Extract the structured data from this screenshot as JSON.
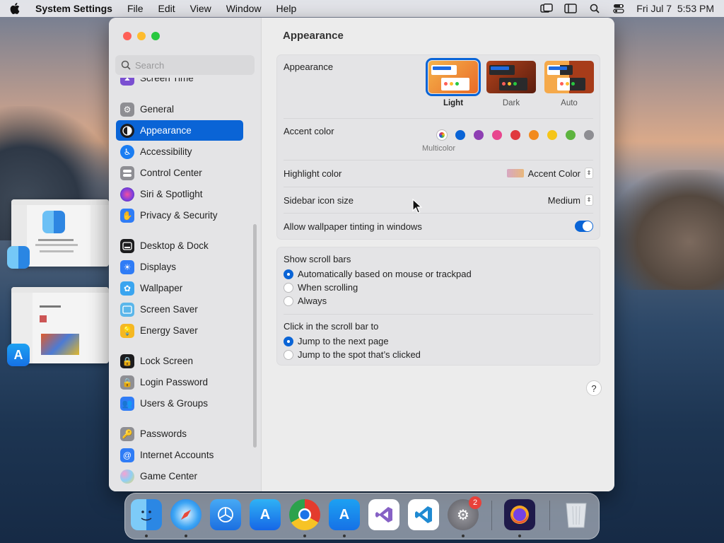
{
  "menubar": {
    "app_name": "System Settings",
    "items": [
      "File",
      "Edit",
      "View",
      "Window",
      "Help"
    ],
    "clock": "Fri Jul 7  5:53 PM"
  },
  "sidebar": {
    "search_placeholder": "Search",
    "partial_item": "Screen Time",
    "items": [
      {
        "label": "General",
        "icon": "gear-icon",
        "color": "#8e8e93"
      },
      {
        "label": "Appearance",
        "icon": "appearance-icon",
        "color": "#1c1c1e",
        "active": true
      },
      {
        "label": "Accessibility",
        "icon": "accessibility-icon",
        "color": "#1a7df2"
      },
      {
        "label": "Control Center",
        "icon": "control-center-icon",
        "color": "#8e8e93"
      },
      {
        "label": "Siri & Spotlight",
        "icon": "siri-icon",
        "color": "#b53cd8"
      },
      {
        "label": "Privacy & Security",
        "icon": "hand-icon",
        "color": "#2f7cf6"
      },
      {
        "label": "Desktop & Dock",
        "icon": "dock-icon",
        "color": "#1c1c1e"
      },
      {
        "label": "Displays",
        "icon": "sun-icon",
        "color": "#2f7cf6"
      },
      {
        "label": "Wallpaper",
        "icon": "flower-icon",
        "color": "#3aa5f0"
      },
      {
        "label": "Screen Saver",
        "icon": "screen-saver-icon",
        "color": "#5ab6ea"
      },
      {
        "label": "Energy Saver",
        "icon": "bulb-icon",
        "color": "#f5b822"
      },
      {
        "label": "Lock Screen",
        "icon": "lock-icon",
        "color": "#1c1c1e"
      },
      {
        "label": "Login Password",
        "icon": "lock-icon",
        "color": "#8e8e93"
      },
      {
        "label": "Users & Groups",
        "icon": "users-icon",
        "color": "#2f7cf6"
      },
      {
        "label": "Passwords",
        "icon": "key-icon",
        "color": "#8e8e93"
      },
      {
        "label": "Internet Accounts",
        "icon": "at-icon",
        "color": "#2f7cf6"
      },
      {
        "label": "Game Center",
        "icon": "game-center-icon",
        "color": "#e5a5d8"
      }
    ]
  },
  "content": {
    "title": "Appearance",
    "appearance_label": "Appearance",
    "appearance_options": [
      "Light",
      "Dark",
      "Auto"
    ],
    "selected_appearance": "Light",
    "accent_label": "Accent color",
    "accent_colors": [
      "#0a64d6",
      "#8e3fb3",
      "#e8468e",
      "#e0393e",
      "#f28a1e",
      "#f5c518",
      "#5db43f",
      "#8e8e93"
    ],
    "multicolor_label": "Multicolor",
    "highlight_label": "Highlight color",
    "highlight_value": "Accent Color",
    "sidebar_icon_label": "Sidebar icon size",
    "sidebar_icon_value": "Medium",
    "tinting_label": "Allow wallpaper tinting in windows",
    "scroll_bars_title": "Show scroll bars",
    "scroll_options": [
      "Automatically based on mouse or trackpad",
      "When scrolling",
      "Always"
    ],
    "click_title": "Click in the scroll bar to",
    "click_options": [
      "Jump to the next page",
      "Jump to the spot that’s clicked"
    ],
    "help": "?"
  },
  "dock": {
    "system_settings_badge": "2"
  }
}
